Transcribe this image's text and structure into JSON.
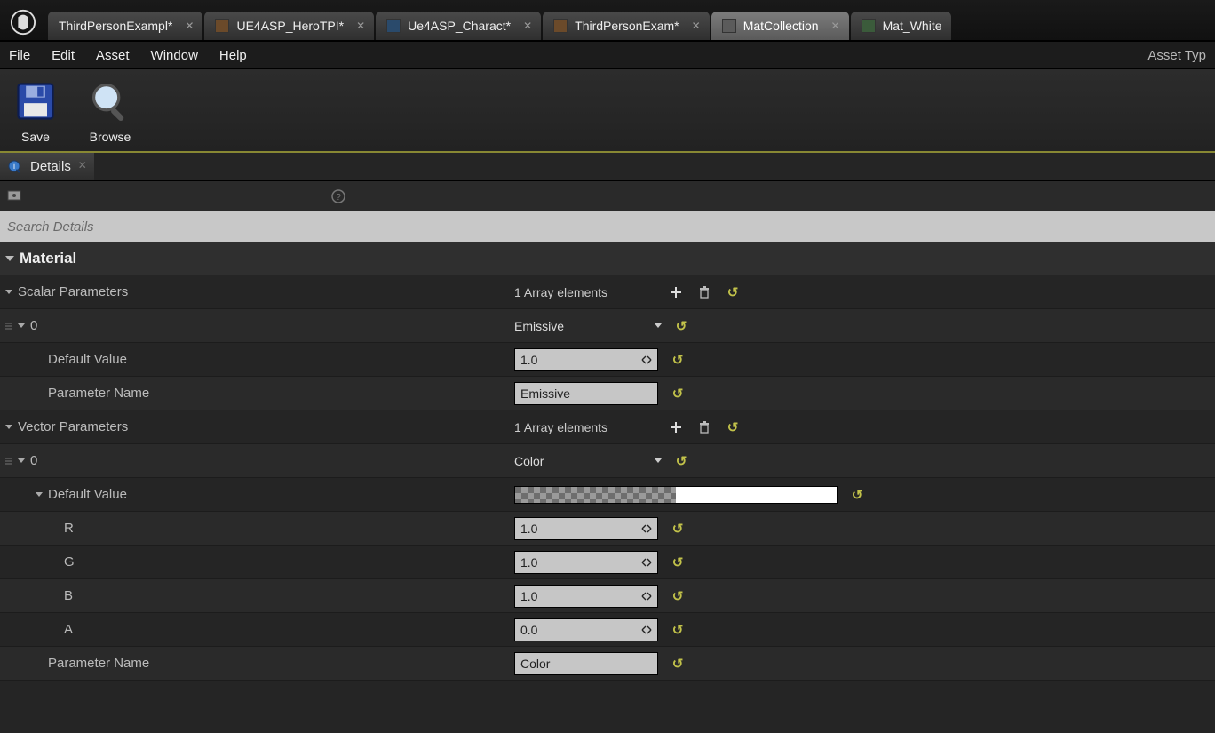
{
  "tabs": [
    {
      "label": "ThirdPersonExampl*",
      "active": false,
      "iconClass": ""
    },
    {
      "label": "UE4ASP_HeroTPI*",
      "active": false,
      "iconClass": "brown"
    },
    {
      "label": "Ue4ASP_Charact*",
      "active": false,
      "iconClass": "blue"
    },
    {
      "label": "ThirdPersonExam*",
      "active": false,
      "iconClass": "brown"
    },
    {
      "label": "MatCollection",
      "active": true,
      "iconClass": "gray"
    },
    {
      "label": "Mat_White",
      "active": false,
      "iconClass": "green"
    }
  ],
  "menu": {
    "file": "File",
    "edit": "Edit",
    "asset": "Asset",
    "window": "Window",
    "help": "Help",
    "right": "Asset Typ"
  },
  "toolbar": {
    "save": "Save",
    "browse": "Browse"
  },
  "detailsTab": {
    "label": "Details"
  },
  "search": {
    "placeholder": "Search Details"
  },
  "category": {
    "material": "Material"
  },
  "scalar": {
    "header": "Scalar Parameters",
    "arrayLabel": "1 Array elements",
    "item0": {
      "index": "0",
      "structName": "Emissive",
      "defaultValueLabel": "Default Value",
      "defaultValue": "1.0",
      "paramNameLabel": "Parameter Name",
      "paramName": "Emissive"
    }
  },
  "vector": {
    "header": "Vector Parameters",
    "arrayLabel": "1 Array elements",
    "item0": {
      "index": "0",
      "structName": "Color",
      "defaultValueLabel": "Default Value",
      "r": {
        "label": "R",
        "value": "1.0"
      },
      "g": {
        "label": "G",
        "value": "1.0"
      },
      "b": {
        "label": "B",
        "value": "1.0"
      },
      "a": {
        "label": "A",
        "value": "0.0"
      },
      "paramNameLabel": "Parameter Name",
      "paramName": "Color",
      "colorHex": "#ffffff"
    }
  }
}
